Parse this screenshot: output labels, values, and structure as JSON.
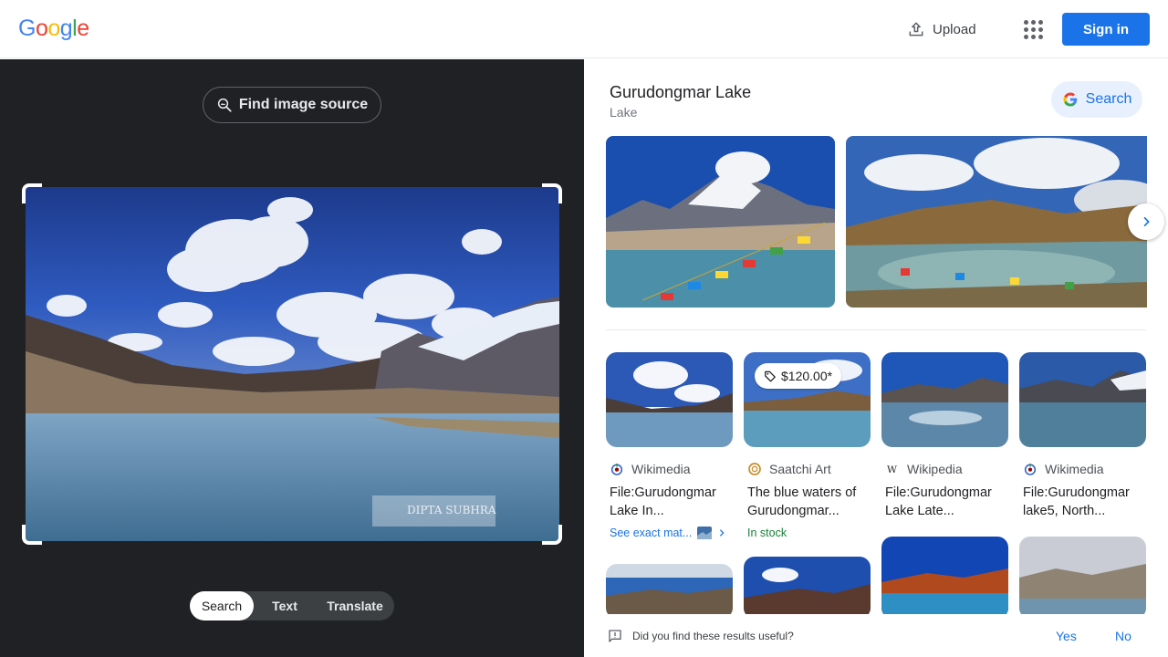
{
  "header": {
    "logo_letters": [
      {
        "ch": "G",
        "color": "#4285F4"
      },
      {
        "ch": "o",
        "color": "#EA4335"
      },
      {
        "ch": "o",
        "color": "#FBBC05"
      },
      {
        "ch": "g",
        "color": "#4285F4"
      },
      {
        "ch": "l",
        "color": "#34A853"
      },
      {
        "ch": "e",
        "color": "#EA4335"
      }
    ],
    "upload_label": "Upload",
    "apps_icon": "apps-grid-icon",
    "signin_label": "Sign in"
  },
  "left": {
    "find_source_label": "Find image source",
    "watermark": "DIPTA SUBHRA",
    "modes": [
      {
        "label": "Search",
        "active": true
      },
      {
        "label": "Text",
        "active": false
      },
      {
        "label": "Translate",
        "active": false
      }
    ]
  },
  "knowledge": {
    "title": "Gurudongmar Lake",
    "subtitle": "Lake",
    "search_label": "Search"
  },
  "results": [
    {
      "source": "Wikimedia",
      "title": "File:Gurudongmar Lake In...",
      "extra": "See exact mat...",
      "extra_type": "exact"
    },
    {
      "source": "Saatchi Art",
      "title": "The blue waters of Gurudongmar...",
      "extra": "In stock",
      "extra_type": "stock",
      "price": "$120.00*"
    },
    {
      "source": "Wikipedia",
      "title": "File:Gurudongmar Lake Late...",
      "extra": "",
      "extra_type": ""
    },
    {
      "source": "Wikimedia",
      "title": "File:Gurudongmar lake5, North...",
      "extra": "",
      "extra_type": ""
    }
  ],
  "feedback": {
    "question": "Did you find these results useful?",
    "yes": "Yes",
    "no": "No"
  },
  "colors": {
    "accent": "#1a73e8",
    "dark_bg": "#202124",
    "stock_green": "#188038"
  }
}
